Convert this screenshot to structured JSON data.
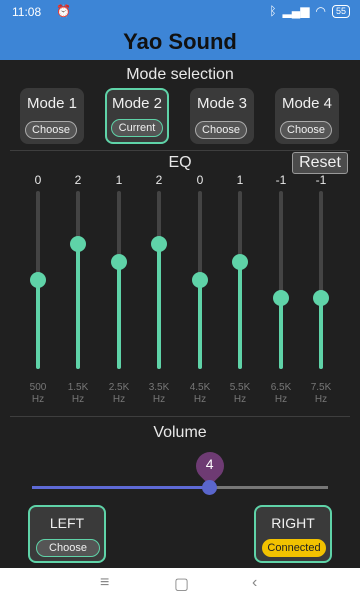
{
  "status_bar": {
    "time": "11:08",
    "alarm_icon": "alarm-icon",
    "battery": "55",
    "icons": [
      "bluetooth-icon",
      "signal-icon",
      "wifi-icon",
      "battery-icon"
    ]
  },
  "app": {
    "title": "Yao Sound",
    "accent_color": "#5fd3a8",
    "header_color": "#3d85d6"
  },
  "mode_selection": {
    "title": "Mode selection",
    "modes": [
      {
        "label": "Mode 1",
        "status": "Choose",
        "active": false
      },
      {
        "label": "Mode 2",
        "status": "Current",
        "active": true
      },
      {
        "label": "Mode 3",
        "status": "Choose",
        "active": false
      },
      {
        "label": "Mode 4",
        "status": "Choose",
        "active": false
      }
    ]
  },
  "eq": {
    "title": "EQ",
    "reset_label": "Reset",
    "range": [
      -5,
      5
    ],
    "bands": [
      {
        "value": "0",
        "level": 0,
        "freq": "500",
        "unit": "Hz"
      },
      {
        "value": "2",
        "level": 2,
        "freq": "1.5K",
        "unit": "Hz"
      },
      {
        "value": "1",
        "level": 1,
        "freq": "2.5K",
        "unit": "Hz"
      },
      {
        "value": "2",
        "level": 2,
        "freq": "3.5K",
        "unit": "Hz"
      },
      {
        "value": "0",
        "level": 0,
        "freq": "4.5K",
        "unit": "Hz"
      },
      {
        "value": "1",
        "level": 1,
        "freq": "5.5K",
        "unit": "Hz"
      },
      {
        "value": "-1",
        "level": -1,
        "freq": "6.5K",
        "unit": "Hz"
      },
      {
        "value": "-1",
        "level": -1,
        "freq": "7.5K",
        "unit": "Hz"
      }
    ]
  },
  "volume": {
    "title": "Volume",
    "value": "4",
    "fraction": 0.6
  },
  "channels": {
    "left": {
      "label": "LEFT",
      "status": "Choose"
    },
    "right": {
      "label": "RIGHT",
      "status": "Connected"
    }
  },
  "nav_bar": {
    "menu": "≡",
    "home": "▢",
    "back": "‹"
  }
}
